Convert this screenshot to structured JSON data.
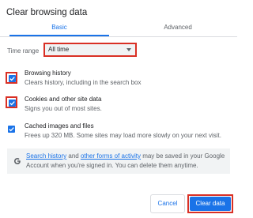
{
  "dialog": {
    "title": "Clear browsing data"
  },
  "tabs": [
    {
      "label": "Basic",
      "selected": true
    },
    {
      "label": "Advanced",
      "selected": false
    }
  ],
  "time_range": {
    "label": "Time range",
    "value": "All time"
  },
  "options": [
    {
      "title": "Browsing history",
      "description": "Clears history, including in the search box",
      "checked": true
    },
    {
      "title": "Cookies and other site data",
      "description": "Signs you out of most sites.",
      "checked": true
    },
    {
      "title": "Cached images and files",
      "description": "Frees up 320 MB. Some sites may load more slowly on your next visit.",
      "checked": true
    }
  ],
  "info": {
    "link1": "Search history",
    "text1": " and ",
    "link2": "other forms of activity",
    "text2": " may be saved in your Google Account when you're signed in. You can delete them anytime."
  },
  "buttons": {
    "cancel": "Cancel",
    "clear": "Clear data"
  },
  "colors": {
    "accent": "#1a73e8",
    "highlight": "#d93025"
  }
}
